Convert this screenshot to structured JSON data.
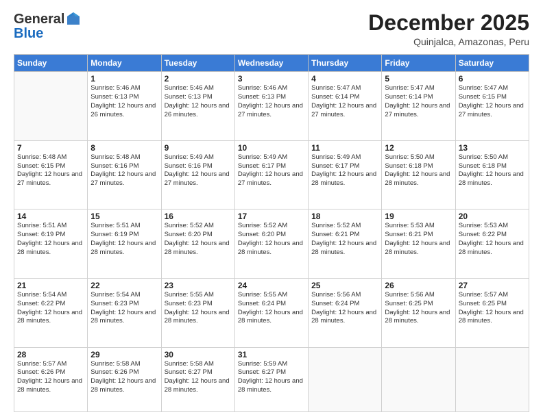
{
  "logo": {
    "general": "General",
    "blue": "Blue"
  },
  "header": {
    "month": "December 2025",
    "location": "Quinjalca, Amazonas, Peru"
  },
  "days_of_week": [
    "Sunday",
    "Monday",
    "Tuesday",
    "Wednesday",
    "Thursday",
    "Friday",
    "Saturday"
  ],
  "weeks": [
    [
      {
        "day": "",
        "info": ""
      },
      {
        "day": "1",
        "info": "Sunrise: 5:46 AM\nSunset: 6:13 PM\nDaylight: 12 hours\nand 26 minutes."
      },
      {
        "day": "2",
        "info": "Sunrise: 5:46 AM\nSunset: 6:13 PM\nDaylight: 12 hours\nand 26 minutes."
      },
      {
        "day": "3",
        "info": "Sunrise: 5:46 AM\nSunset: 6:13 PM\nDaylight: 12 hours\nand 27 minutes."
      },
      {
        "day": "4",
        "info": "Sunrise: 5:47 AM\nSunset: 6:14 PM\nDaylight: 12 hours\nand 27 minutes."
      },
      {
        "day": "5",
        "info": "Sunrise: 5:47 AM\nSunset: 6:14 PM\nDaylight: 12 hours\nand 27 minutes."
      },
      {
        "day": "6",
        "info": "Sunrise: 5:47 AM\nSunset: 6:15 PM\nDaylight: 12 hours\nand 27 minutes."
      }
    ],
    [
      {
        "day": "7",
        "info": "Sunrise: 5:48 AM\nSunset: 6:15 PM\nDaylight: 12 hours\nand 27 minutes."
      },
      {
        "day": "8",
        "info": "Sunrise: 5:48 AM\nSunset: 6:16 PM\nDaylight: 12 hours\nand 27 minutes."
      },
      {
        "day": "9",
        "info": "Sunrise: 5:49 AM\nSunset: 6:16 PM\nDaylight: 12 hours\nand 27 minutes."
      },
      {
        "day": "10",
        "info": "Sunrise: 5:49 AM\nSunset: 6:17 PM\nDaylight: 12 hours\nand 27 minutes."
      },
      {
        "day": "11",
        "info": "Sunrise: 5:49 AM\nSunset: 6:17 PM\nDaylight: 12 hours\nand 28 minutes."
      },
      {
        "day": "12",
        "info": "Sunrise: 5:50 AM\nSunset: 6:18 PM\nDaylight: 12 hours\nand 28 minutes."
      },
      {
        "day": "13",
        "info": "Sunrise: 5:50 AM\nSunset: 6:18 PM\nDaylight: 12 hours\nand 28 minutes."
      }
    ],
    [
      {
        "day": "14",
        "info": "Sunrise: 5:51 AM\nSunset: 6:19 PM\nDaylight: 12 hours\nand 28 minutes."
      },
      {
        "day": "15",
        "info": "Sunrise: 5:51 AM\nSunset: 6:19 PM\nDaylight: 12 hours\nand 28 minutes."
      },
      {
        "day": "16",
        "info": "Sunrise: 5:52 AM\nSunset: 6:20 PM\nDaylight: 12 hours\nand 28 minutes."
      },
      {
        "day": "17",
        "info": "Sunrise: 5:52 AM\nSunset: 6:20 PM\nDaylight: 12 hours\nand 28 minutes."
      },
      {
        "day": "18",
        "info": "Sunrise: 5:52 AM\nSunset: 6:21 PM\nDaylight: 12 hours\nand 28 minutes."
      },
      {
        "day": "19",
        "info": "Sunrise: 5:53 AM\nSunset: 6:21 PM\nDaylight: 12 hours\nand 28 minutes."
      },
      {
        "day": "20",
        "info": "Sunrise: 5:53 AM\nSunset: 6:22 PM\nDaylight: 12 hours\nand 28 minutes."
      }
    ],
    [
      {
        "day": "21",
        "info": "Sunrise: 5:54 AM\nSunset: 6:22 PM\nDaylight: 12 hours\nand 28 minutes."
      },
      {
        "day": "22",
        "info": "Sunrise: 5:54 AM\nSunset: 6:23 PM\nDaylight: 12 hours\nand 28 minutes."
      },
      {
        "day": "23",
        "info": "Sunrise: 5:55 AM\nSunset: 6:23 PM\nDaylight: 12 hours\nand 28 minutes."
      },
      {
        "day": "24",
        "info": "Sunrise: 5:55 AM\nSunset: 6:24 PM\nDaylight: 12 hours\nand 28 minutes."
      },
      {
        "day": "25",
        "info": "Sunrise: 5:56 AM\nSunset: 6:24 PM\nDaylight: 12 hours\nand 28 minutes."
      },
      {
        "day": "26",
        "info": "Sunrise: 5:56 AM\nSunset: 6:25 PM\nDaylight: 12 hours\nand 28 minutes."
      },
      {
        "day": "27",
        "info": "Sunrise: 5:57 AM\nSunset: 6:25 PM\nDaylight: 12 hours\nand 28 minutes."
      }
    ],
    [
      {
        "day": "28",
        "info": "Sunrise: 5:57 AM\nSunset: 6:26 PM\nDaylight: 12 hours\nand 28 minutes."
      },
      {
        "day": "29",
        "info": "Sunrise: 5:58 AM\nSunset: 6:26 PM\nDaylight: 12 hours\nand 28 minutes."
      },
      {
        "day": "30",
        "info": "Sunrise: 5:58 AM\nSunset: 6:27 PM\nDaylight: 12 hours\nand 28 minutes."
      },
      {
        "day": "31",
        "info": "Sunrise: 5:59 AM\nSunset: 6:27 PM\nDaylight: 12 hours\nand 28 minutes."
      },
      {
        "day": "",
        "info": ""
      },
      {
        "day": "",
        "info": ""
      },
      {
        "day": "",
        "info": ""
      }
    ]
  ]
}
